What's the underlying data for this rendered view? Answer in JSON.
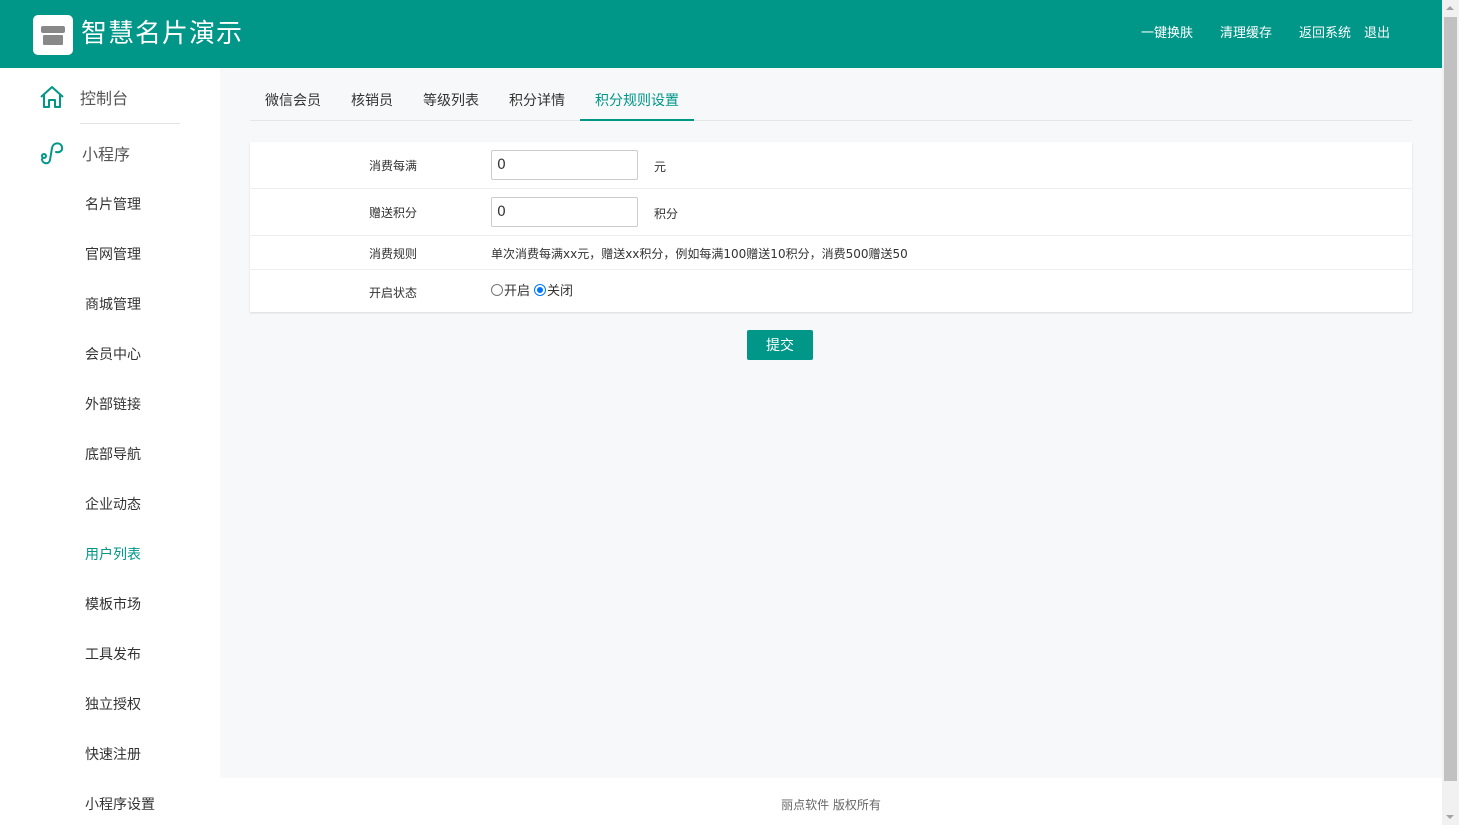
{
  "header": {
    "title": "智慧名片演示",
    "logo_icon": "store-icon",
    "nav": [
      "一键换肤",
      "清理缓存",
      "返回系统",
      "退出"
    ],
    "bg_color": "#009688"
  },
  "sidebar": {
    "top_items": [
      {
        "label": "控制台",
        "icon": "home-icon"
      },
      {
        "label": "小程序",
        "icon": "miniprogram-icon"
      }
    ],
    "items": [
      {
        "label": "名片管理",
        "active": false
      },
      {
        "label": "官网管理",
        "active": false
      },
      {
        "label": "商城管理",
        "active": false
      },
      {
        "label": "会员中心",
        "active": false
      },
      {
        "label": "外部链接",
        "active": false
      },
      {
        "label": "底部导航",
        "active": false
      },
      {
        "label": "企业动态",
        "active": false
      },
      {
        "label": "用户列表",
        "active": true
      },
      {
        "label": "模板市场",
        "active": false
      },
      {
        "label": "工具发布",
        "active": false
      },
      {
        "label": "独立授权",
        "active": false
      },
      {
        "label": "快速注册",
        "active": false
      },
      {
        "label": "小程序设置",
        "active": false
      }
    ]
  },
  "tabs": [
    {
      "label": "微信会员",
      "active": false
    },
    {
      "label": "核销员",
      "active": false
    },
    {
      "label": "等级列表",
      "active": false
    },
    {
      "label": "积分详情",
      "active": false
    },
    {
      "label": "积分规则设置",
      "active": true
    }
  ],
  "form": {
    "spend_label": "消费每满",
    "spend_value": "0",
    "spend_unit": "元",
    "gift_label": "赠送积分",
    "gift_value": "0",
    "gift_unit": "积分",
    "rule_label": "消费规则",
    "rule_text": "单次消费每满xx元，赠送xx积分，例如每满100赠送10积分，消费500赠送50",
    "status_label": "开启状态",
    "status_options": [
      "开启",
      "关闭"
    ],
    "status_selected": "关闭"
  },
  "submit_label": "提交",
  "footer": "丽点软件 版权所有",
  "accent_color": "#009688"
}
